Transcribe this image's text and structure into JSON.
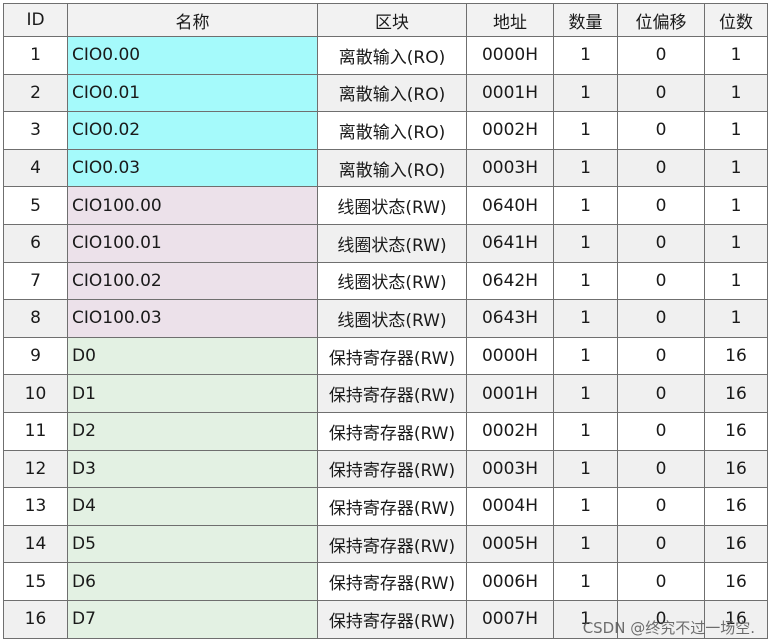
{
  "headers": [
    "ID",
    "名称",
    "区块",
    "地址",
    "数量",
    "位偏移",
    "位数"
  ],
  "colors": {
    "cyan": "#a5fafb",
    "pink": "#ece1ea",
    "green": "#e3f1e3"
  },
  "rows": [
    {
      "id": "1",
      "name": "CIO0.00",
      "block": "离散输入(RO)",
      "addr": "0000H",
      "qty": "1",
      "bitoff": "0",
      "bits": "1",
      "group": "cyan"
    },
    {
      "id": "2",
      "name": "CIO0.01",
      "block": "离散输入(RO)",
      "addr": "0001H",
      "qty": "1",
      "bitoff": "0",
      "bits": "1",
      "group": "cyan"
    },
    {
      "id": "3",
      "name": "CIO0.02",
      "block": "离散输入(RO)",
      "addr": "0002H",
      "qty": "1",
      "bitoff": "0",
      "bits": "1",
      "group": "cyan"
    },
    {
      "id": "4",
      "name": "CIO0.03",
      "block": "离散输入(RO)",
      "addr": "0003H",
      "qty": "1",
      "bitoff": "0",
      "bits": "1",
      "group": "cyan"
    },
    {
      "id": "5",
      "name": "CIO100.00",
      "block": "线圈状态(RW)",
      "addr": "0640H",
      "qty": "1",
      "bitoff": "0",
      "bits": "1",
      "group": "pink"
    },
    {
      "id": "6",
      "name": "CIO100.01",
      "block": "线圈状态(RW)",
      "addr": "0641H",
      "qty": "1",
      "bitoff": "0",
      "bits": "1",
      "group": "pink"
    },
    {
      "id": "7",
      "name": "CIO100.02",
      "block": "线圈状态(RW)",
      "addr": "0642H",
      "qty": "1",
      "bitoff": "0",
      "bits": "1",
      "group": "pink"
    },
    {
      "id": "8",
      "name": "CIO100.03",
      "block": "线圈状态(RW)",
      "addr": "0643H",
      "qty": "1",
      "bitoff": "0",
      "bits": "1",
      "group": "pink"
    },
    {
      "id": "9",
      "name": "D0",
      "block": "保持寄存器(RW)",
      "addr": "0000H",
      "qty": "1",
      "bitoff": "0",
      "bits": "16",
      "group": "green"
    },
    {
      "id": "10",
      "name": "D1",
      "block": "保持寄存器(RW)",
      "addr": "0001H",
      "qty": "1",
      "bitoff": "0",
      "bits": "16",
      "group": "green"
    },
    {
      "id": "11",
      "name": "D2",
      "block": "保持寄存器(RW)",
      "addr": "0002H",
      "qty": "1",
      "bitoff": "0",
      "bits": "16",
      "group": "green"
    },
    {
      "id": "12",
      "name": "D3",
      "block": "保持寄存器(RW)",
      "addr": "0003H",
      "qty": "1",
      "bitoff": "0",
      "bits": "16",
      "group": "green"
    },
    {
      "id": "13",
      "name": "D4",
      "block": "保持寄存器(RW)",
      "addr": "0004H",
      "qty": "1",
      "bitoff": "0",
      "bits": "16",
      "group": "green"
    },
    {
      "id": "14",
      "name": "D5",
      "block": "保持寄存器(RW)",
      "addr": "0005H",
      "qty": "1",
      "bitoff": "0",
      "bits": "16",
      "group": "green"
    },
    {
      "id": "15",
      "name": "D6",
      "block": "保持寄存器(RW)",
      "addr": "0006H",
      "qty": "1",
      "bitoff": "0",
      "bits": "16",
      "group": "green"
    },
    {
      "id": "16",
      "name": "D7",
      "block": "保持寄存器(RW)",
      "addr": "0007H",
      "qty": "1",
      "bitoff": "0",
      "bits": "16",
      "group": "green"
    }
  ],
  "watermark": "CSDN @终究不过一场空."
}
